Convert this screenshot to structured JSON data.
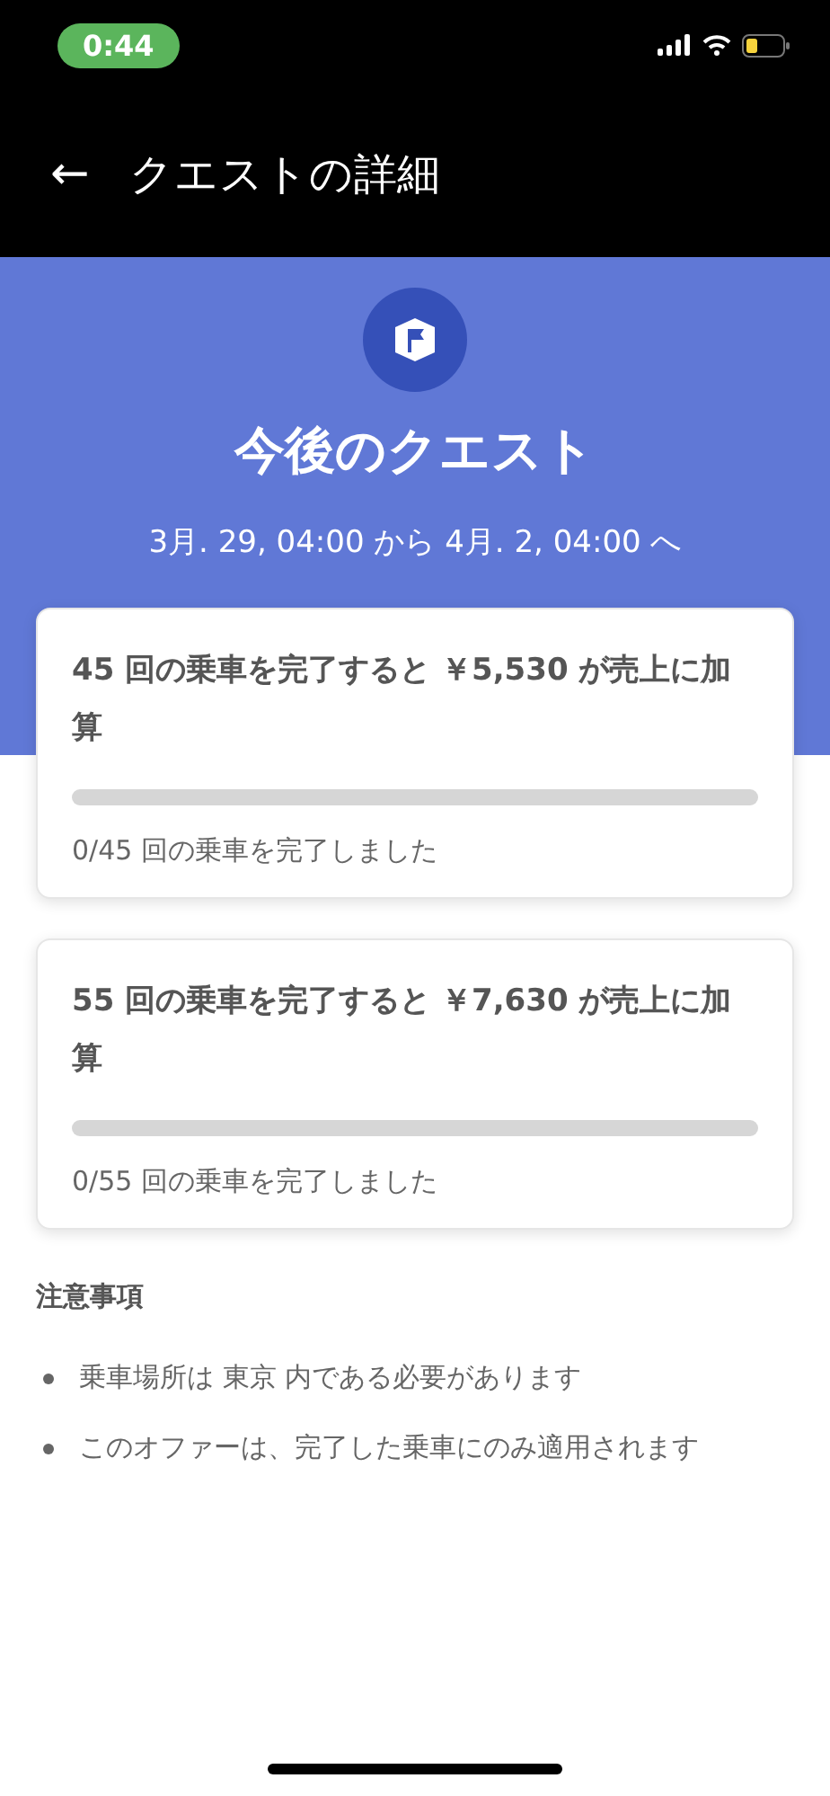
{
  "status_bar": {
    "time": "0:44"
  },
  "header": {
    "back": "←",
    "title": "クエストの詳細"
  },
  "hero": {
    "title": "今後のクエスト",
    "period": "3月. 29, 04:00 から 4月. 2, 04:00 へ"
  },
  "quests": [
    {
      "goal": "45 回の乗車を完了すると ￥5,530 が売上に加算",
      "level": 0,
      "progress": "0/45 回の乗車を完了しました"
    },
    {
      "goal": "55 回の乗車を完了すると ￥7,630 が売上に加算",
      "level": 0,
      "progress": "0/55 回の乗車を完了しました"
    }
  ],
  "notes": {
    "title": "注意事項",
    "items": [
      "乗車場所は 東京 内である必要があります",
      "このオファーは、完了した乗車にのみ適用されます"
    ]
  }
}
